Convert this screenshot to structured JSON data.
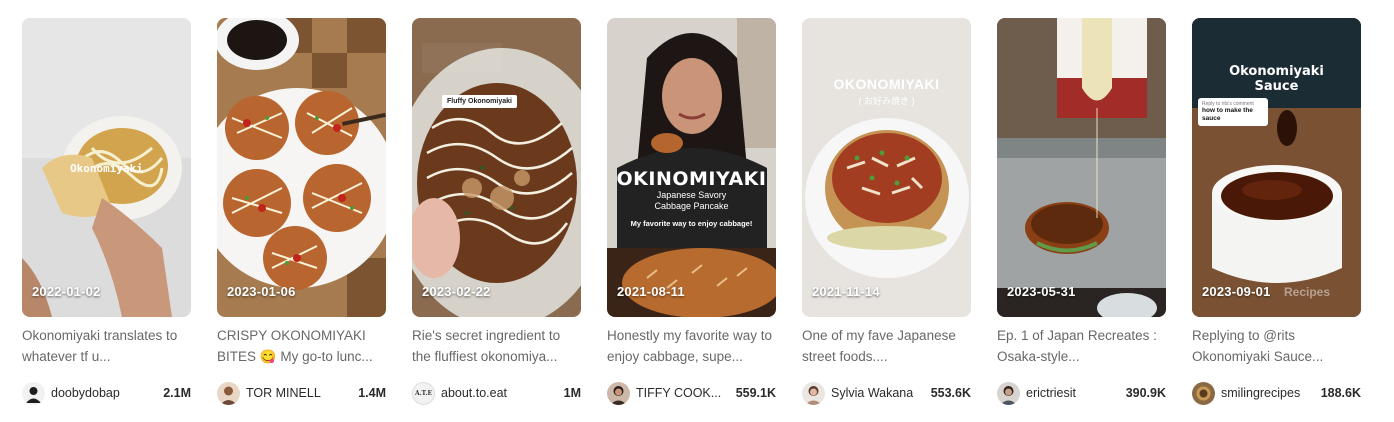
{
  "cards": [
    {
      "date": "2022-01-02",
      "overlay": "Okonomiyaki",
      "caption": "Okonomiyaki translates to whatever tf u...",
      "creator": "doobydobap",
      "views": "2.1M"
    },
    {
      "date": "2023-01-06",
      "caption": "CRISPY OKONOMIYAKI BITES 😋 My go-to lunc...",
      "creator": "TOR MINELL",
      "views": "1.4M"
    },
    {
      "date": "2023-02-22",
      "overlay": "Fluffy Okonomiyaki",
      "caption": "Rie's secret ingredient to the fluffiest okonomiya...",
      "creator": "about.to.eat",
      "avatar_text": "A.T.E",
      "views": "1M"
    },
    {
      "date": "2021-08-11",
      "overlay": "OKINOMIYAKI",
      "overlay_sub1": "Japanese Savory",
      "overlay_sub2": "Cabbage Pancake",
      "overlay_sub3": "My favorite way to enjoy cabbage!",
      "caption": "Honestly my favorite way to enjoy cabbage, supe...",
      "creator": "TIFFY COOK...",
      "views": "559.1K"
    },
    {
      "date": "2021-11-14",
      "overlay": "OKONOMIYAKI",
      "overlay_sub1": "( お好み焼き )",
      "caption": "One of my fave Japanese street foods....",
      "creator": "Sylvia Wakana",
      "views": "553.6K"
    },
    {
      "date": "2023-05-31",
      "caption": "Ep. 1 of Japan Recreates : Osaka-style...",
      "creator": "erictriesit",
      "views": "390.9K"
    },
    {
      "date": "2023-09-01",
      "overlay": "Okonomiyaki",
      "overlay_sub1": "Sauce",
      "reply_label": "Reply to rits's comment",
      "reply_text": "how to make the sauce",
      "watermark": "Recipes",
      "caption": "Replying to @rits Okonomiyaki Sauce...",
      "creator": "smilingrecipes",
      "views": "188.6K"
    }
  ]
}
